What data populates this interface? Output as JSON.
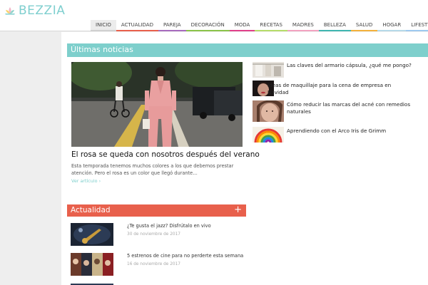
{
  "site": {
    "logo_text": "BEZZIA"
  },
  "nav": {
    "items": [
      {
        "label": "INICIO",
        "color": "#cfcfcf"
      },
      {
        "label": "ACTUALIDAD",
        "color": "#e8604c"
      },
      {
        "label": "PAREJA",
        "color": "#a66bbd"
      },
      {
        "label": "DECORACIÓN",
        "color": "#8bc34a"
      },
      {
        "label": "MODA",
        "color": "#e0408a"
      },
      {
        "label": "RECETAS",
        "color": "#b6dc6a"
      },
      {
        "label": "MADRES",
        "color": "#f2a3c0"
      },
      {
        "label": "BELLEZA",
        "color": "#3fb6b0"
      },
      {
        "label": "SALUD",
        "color": "#f3b13c"
      },
      {
        "label": "HOGAR",
        "color": "#b6d9e8"
      },
      {
        "label": "LIFESTYLE",
        "color": "#9ec9ef"
      }
    ]
  },
  "ultimas": {
    "heading": "Últimas noticias",
    "color": "#7ecfcc",
    "featured": {
      "title": "El rosa se queda con nosotros después del verano",
      "excerpt": "Esta temporada tenemos muchos colores a los que debemos prestar atención. Pero el rosa es un color que llegó durante…",
      "more": "Ver artículo ›"
    },
    "side": [
      {
        "title": "Las claves del armario cápsula, ¿qué me pongo?"
      },
      {
        "title": "Ideas de maquillaje para la cena de empresa en Navidad"
      },
      {
        "title": "Cómo reducir las marcas del acné con remedios naturales"
      },
      {
        "title": "Aprendiendo con el Arco Iris de Grimm"
      }
    ]
  },
  "actualidad": {
    "heading": "Actualidad",
    "plus": "+",
    "color": "#e8604c",
    "items": [
      {
        "title": "¿Te gusta el jazz? Disfrútalo en vivo",
        "date": "30 de noviembre de 2017"
      },
      {
        "title": "5 estrenos de cine para no perderte esta semana",
        "date": "16 de noviembre de 2017"
      }
    ]
  }
}
